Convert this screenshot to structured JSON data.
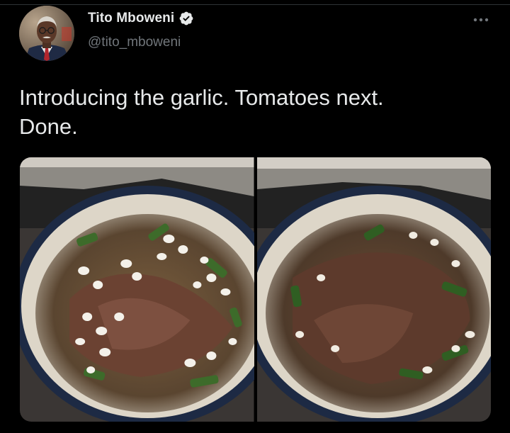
{
  "tweet": {
    "author": {
      "display_name": "Tito Mboweni",
      "handle": "@tito_mboweni",
      "verified": true
    },
    "text_line1": "Introducing the garlic. Tomatoes next.",
    "text_line2": "Done.",
    "media": [
      {
        "alt": "Pan of meat with peppers and garlic cloves"
      },
      {
        "alt": "Pan of meat with peppers and garlic cloves, cooked"
      }
    ]
  },
  "icons": {
    "verified": "verified-badge-icon",
    "more": "more-horizontal-icon"
  },
  "colors": {
    "background": "#000000",
    "text_primary": "#e7e9ea",
    "text_secondary": "#71767b"
  }
}
